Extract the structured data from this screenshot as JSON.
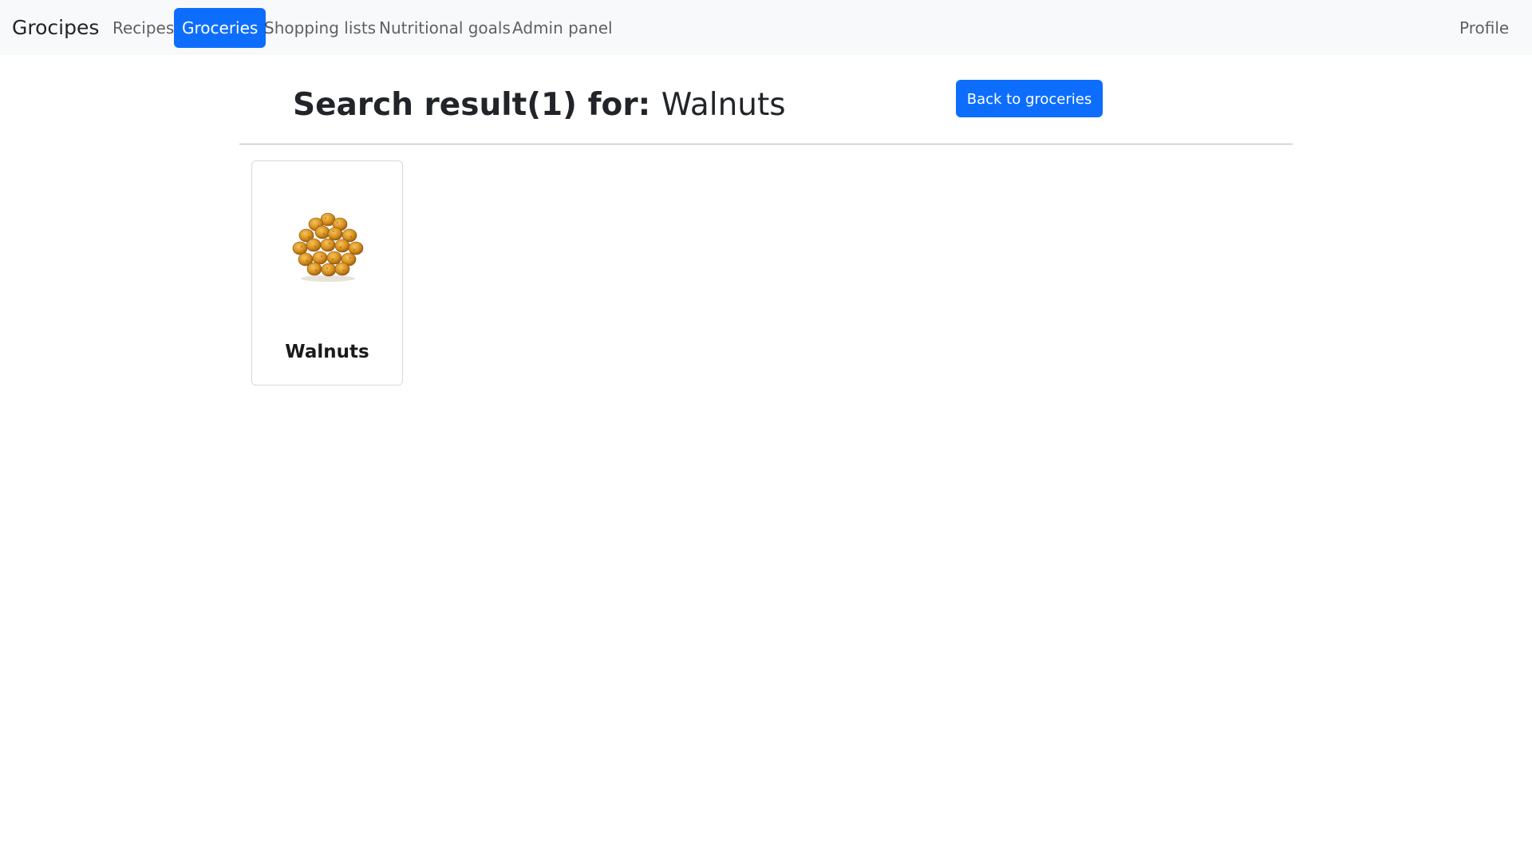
{
  "navbar": {
    "brand": "Grocipes",
    "items": [
      {
        "label": "Recipes",
        "active": false
      },
      {
        "label": "Groceries",
        "active": true
      },
      {
        "label": "Shopping lists",
        "active": false
      },
      {
        "label": "Nutritional goals",
        "active": false
      },
      {
        "label": "Admin panel",
        "active": false
      }
    ],
    "profile_label": "Profile"
  },
  "header": {
    "title_label": "Search result(1) for:",
    "query": "Walnuts",
    "back_button_label": "Back to groceries"
  },
  "results": [
    {
      "name": "Walnuts",
      "image_icon": "walnut-pile-image"
    }
  ],
  "colors": {
    "accent": "#0d6efd",
    "navbar_bg": "#f8f9fa"
  }
}
